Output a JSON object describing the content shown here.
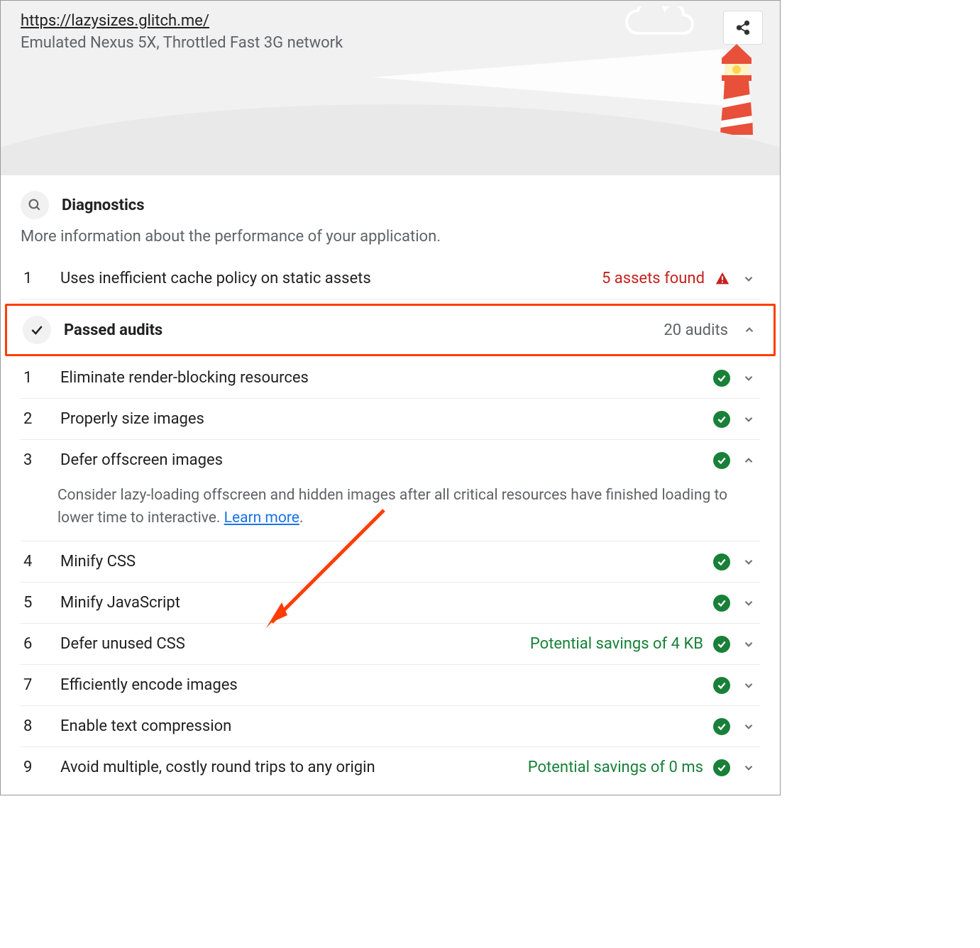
{
  "header": {
    "url": "https://lazysizes.glitch.me/",
    "subtitle": "Emulated Nexus 5X, Throttled Fast 3G network"
  },
  "diagnostics": {
    "title": "Diagnostics",
    "description": "More information about the performance of your application.",
    "items": [
      {
        "num": "1",
        "title": "Uses inefficient cache policy on static assets",
        "right": "5 assets found",
        "status": "fail"
      }
    ]
  },
  "passed": {
    "title": "Passed audits",
    "count_label": "20 audits",
    "items": [
      {
        "num": "1",
        "title": "Eliminate render-blocking resources",
        "right": "",
        "expanded": false
      },
      {
        "num": "2",
        "title": "Properly size images",
        "right": "",
        "expanded": false
      },
      {
        "num": "3",
        "title": "Defer offscreen images",
        "right": "",
        "expanded": true,
        "detail": "Consider lazy-loading offscreen and hidden images after all critical resources have finished loading to lower time to interactive. ",
        "link": "Learn more"
      },
      {
        "num": "4",
        "title": "Minify CSS",
        "right": "",
        "expanded": false
      },
      {
        "num": "5",
        "title": "Minify JavaScript",
        "right": "",
        "expanded": false
      },
      {
        "num": "6",
        "title": "Defer unused CSS",
        "right": "Potential savings of 4 KB",
        "expanded": false
      },
      {
        "num": "7",
        "title": "Efficiently encode images",
        "right": "",
        "expanded": false
      },
      {
        "num": "8",
        "title": "Enable text compression",
        "right": "",
        "expanded": false
      },
      {
        "num": "9",
        "title": "Avoid multiple, costly round trips to any origin",
        "right": "Potential savings of 0 ms",
        "expanded": false
      }
    ]
  }
}
